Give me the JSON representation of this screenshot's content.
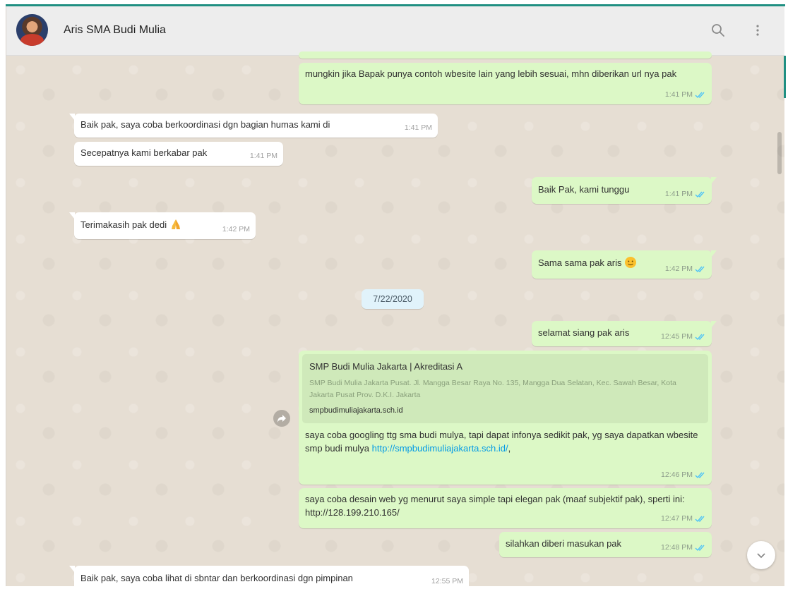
{
  "header": {
    "contact_name": "Aris SMA Budi Mulia"
  },
  "date_separator": "7/22/2020",
  "messages": [
    {
      "dir": "out",
      "text": "mungkin jika Bapak punya contoh wbesite lain yang lebih sesuai, mhn diberikan url nya pak",
      "time": "1:41 PM"
    },
    {
      "dir": "in",
      "text": "Baik pak, saya coba berkoordinasi dgn bagian humas kami di",
      "time": "1:41 PM"
    },
    {
      "dir": "in",
      "text": "Secepatnya kami berkabar pak",
      "time": "1:41 PM"
    },
    {
      "dir": "out",
      "text": "Baik Pak, kami tunggu",
      "time": "1:41 PM"
    },
    {
      "dir": "in",
      "text": "Terimakasih pak dedi",
      "time": "1:42 PM"
    },
    {
      "dir": "out",
      "text": "Sama sama pak aris",
      "time": "1:42 PM"
    },
    {
      "dir": "out",
      "text": "selamat siang pak aris",
      "time": "12:45 PM"
    },
    {
      "dir": "out",
      "text": "saya coba googling ttg sma budi mulya, tapi dapat infonya sedikit pak, yg saya dapatkan wbesite smp budi mulya",
      "link": "http://smpbudimuliajakarta.sch.id/",
      "suffix": ",",
      "time": "12:46 PM",
      "preview": {
        "title": "SMP Budi Mulia Jakarta | Akreditasi A",
        "description": "SMP Budi Mulia Jakarta Pusat. Jl. Mangga Besar Raya No. 135, Mangga Dua Selatan, Kec. Sawah Besar, Kota Jakarta Pusat Prov. D.K.I. Jakarta",
        "domain": "smpbudimuliajakarta.sch.id"
      }
    },
    {
      "dir": "out",
      "text": "saya coba desain web yg menurut saya simple tapi elegan pak (maaf subjektif pak), sperti ini: http://128.199.210.165/",
      "time": "12:47 PM"
    },
    {
      "dir": "out",
      "text": "silahkan diberi masukan pak",
      "time": "12:48 PM"
    },
    {
      "dir": "in",
      "text": "Baik pak, saya coba lihat di sbntar dan berkoordinasi dgn pimpinan",
      "time": "12:55 PM"
    }
  ],
  "icons": {
    "search": "search-icon",
    "menu": "kebab-menu-icon",
    "forward": "forward-icon",
    "scroll_down": "chevron-down-icon",
    "read_receipt": "double-check-icon",
    "praying_hands": "praying-hands-emoji",
    "smile": "smiling-face-emoji"
  },
  "colors": {
    "accent": "#1f8f82",
    "outgoing_bubble": "#dcf8c6",
    "incoming_bubble": "#ffffff",
    "read_tick": "#4fc3f7",
    "date_pill": "#e1f3fb",
    "link": "#039be5"
  }
}
